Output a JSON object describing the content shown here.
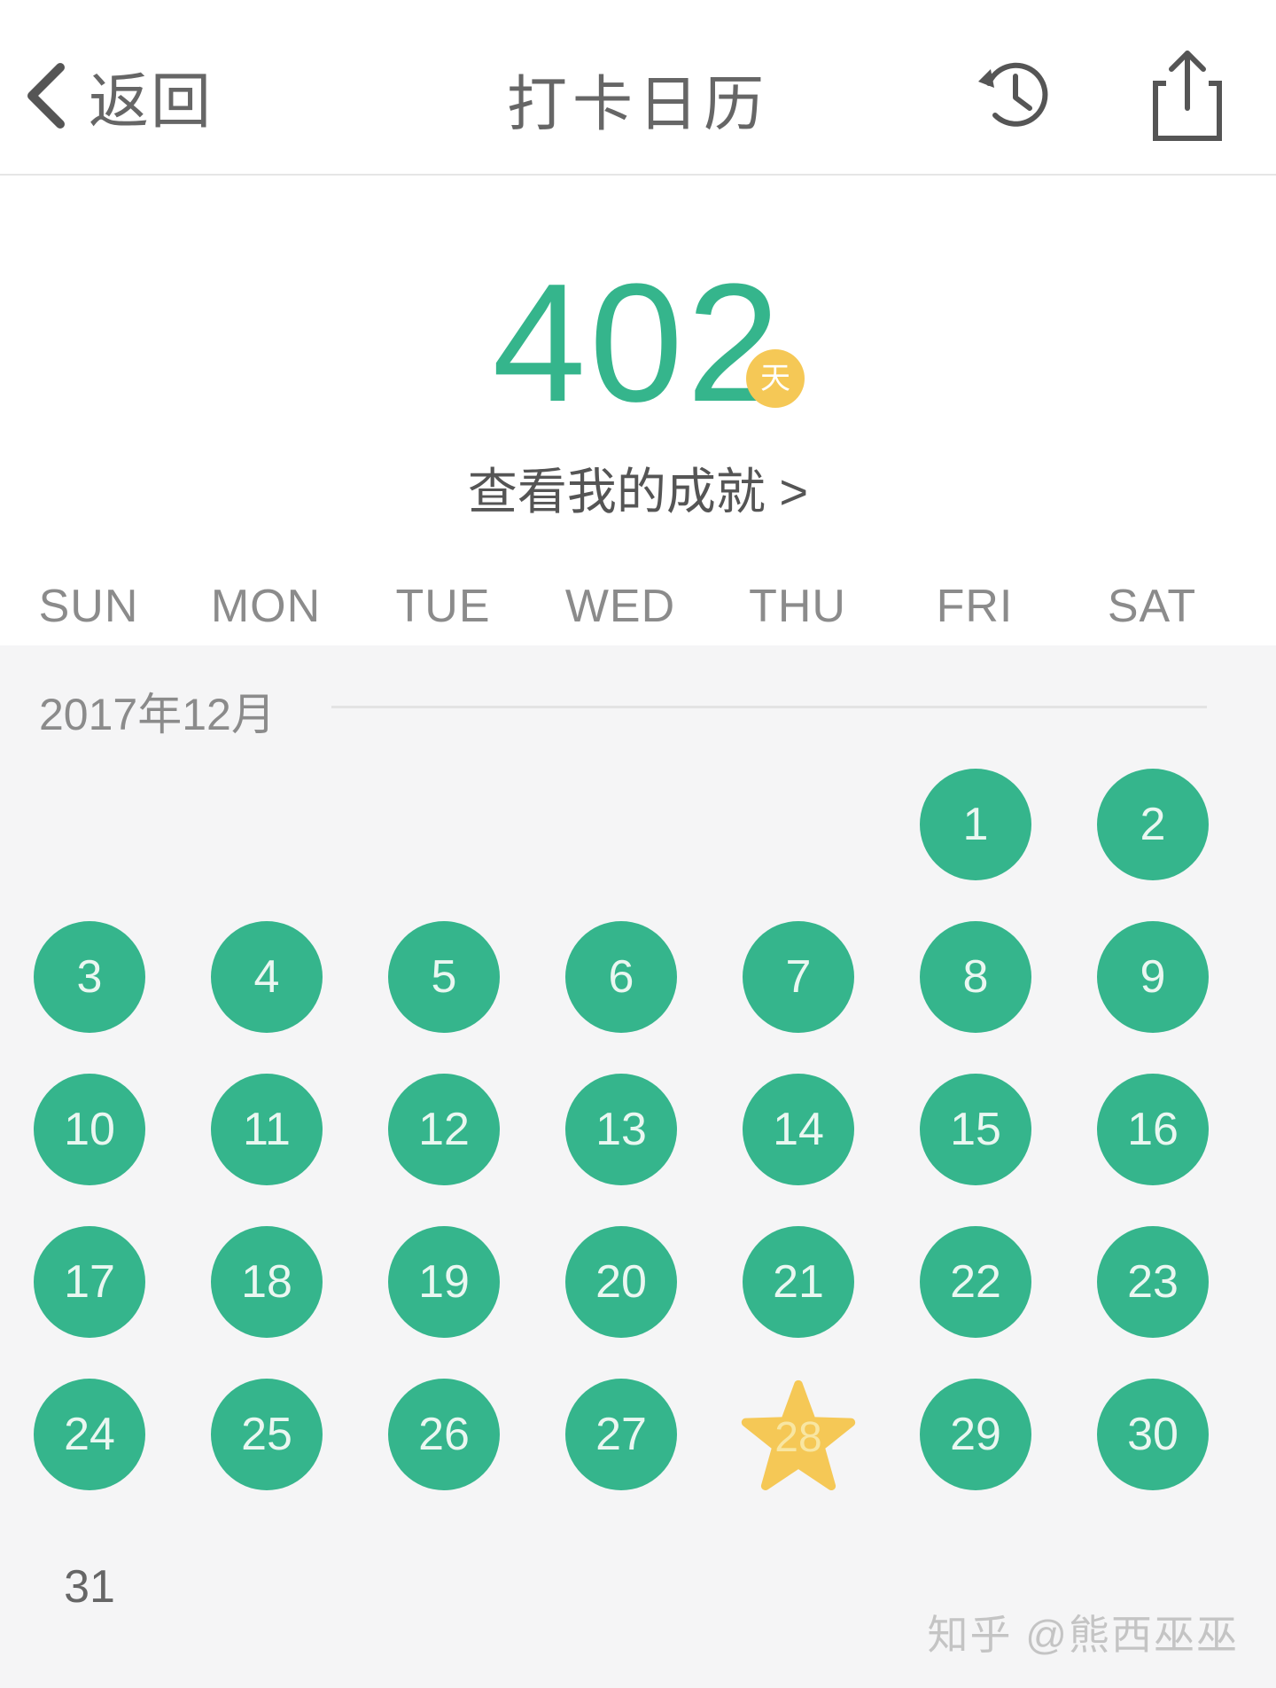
{
  "header": {
    "back_label": "返回",
    "title": "打卡日历",
    "history_icon": "history-icon",
    "share_icon": "share-icon"
  },
  "summary": {
    "streak_days": "402",
    "unit_badge": "天",
    "achievements_link": "查看我的成就 >"
  },
  "weekdays": [
    "SUN",
    "MON",
    "TUE",
    "WED",
    "THU",
    "FRI",
    "SAT"
  ],
  "calendar": {
    "month_label": "2017年12月",
    "checked_color": "#35b58c",
    "special_color": "#f5c856",
    "days": [
      {
        "day": "1",
        "weekday": 5,
        "week": 0,
        "status": "checked"
      },
      {
        "day": "2",
        "weekday": 6,
        "week": 0,
        "status": "checked"
      },
      {
        "day": "3",
        "weekday": 0,
        "week": 1,
        "status": "checked"
      },
      {
        "day": "4",
        "weekday": 1,
        "week": 1,
        "status": "checked"
      },
      {
        "day": "5",
        "weekday": 2,
        "week": 1,
        "status": "checked"
      },
      {
        "day": "6",
        "weekday": 3,
        "week": 1,
        "status": "checked"
      },
      {
        "day": "7",
        "weekday": 4,
        "week": 1,
        "status": "checked"
      },
      {
        "day": "8",
        "weekday": 5,
        "week": 1,
        "status": "checked"
      },
      {
        "day": "9",
        "weekday": 6,
        "week": 1,
        "status": "checked"
      },
      {
        "day": "10",
        "weekday": 0,
        "week": 2,
        "status": "checked"
      },
      {
        "day": "11",
        "weekday": 1,
        "week": 2,
        "status": "checked"
      },
      {
        "day": "12",
        "weekday": 2,
        "week": 2,
        "status": "checked"
      },
      {
        "day": "13",
        "weekday": 3,
        "week": 2,
        "status": "checked"
      },
      {
        "day": "14",
        "weekday": 4,
        "week": 2,
        "status": "checked"
      },
      {
        "day": "15",
        "weekday": 5,
        "week": 2,
        "status": "checked"
      },
      {
        "day": "16",
        "weekday": 6,
        "week": 2,
        "status": "checked"
      },
      {
        "day": "17",
        "weekday": 0,
        "week": 3,
        "status": "checked"
      },
      {
        "day": "18",
        "weekday": 1,
        "week": 3,
        "status": "checked"
      },
      {
        "day": "19",
        "weekday": 2,
        "week": 3,
        "status": "checked"
      },
      {
        "day": "20",
        "weekday": 3,
        "week": 3,
        "status": "checked"
      },
      {
        "day": "21",
        "weekday": 4,
        "week": 3,
        "status": "checked"
      },
      {
        "day": "22",
        "weekday": 5,
        "week": 3,
        "status": "checked"
      },
      {
        "day": "23",
        "weekday": 6,
        "week": 3,
        "status": "checked"
      },
      {
        "day": "24",
        "weekday": 0,
        "week": 4,
        "status": "checked"
      },
      {
        "day": "25",
        "weekday": 1,
        "week": 4,
        "status": "checked"
      },
      {
        "day": "26",
        "weekday": 2,
        "week": 4,
        "status": "checked"
      },
      {
        "day": "27",
        "weekday": 3,
        "week": 4,
        "status": "checked"
      },
      {
        "day": "28",
        "weekday": 4,
        "week": 4,
        "status": "star"
      },
      {
        "day": "29",
        "weekday": 5,
        "week": 4,
        "status": "checked"
      },
      {
        "day": "30",
        "weekday": 6,
        "week": 4,
        "status": "checked"
      },
      {
        "day": "31",
        "weekday": 0,
        "week": 5,
        "status": "unchecked"
      }
    ]
  },
  "watermark": "知乎 @熊西巫巫"
}
